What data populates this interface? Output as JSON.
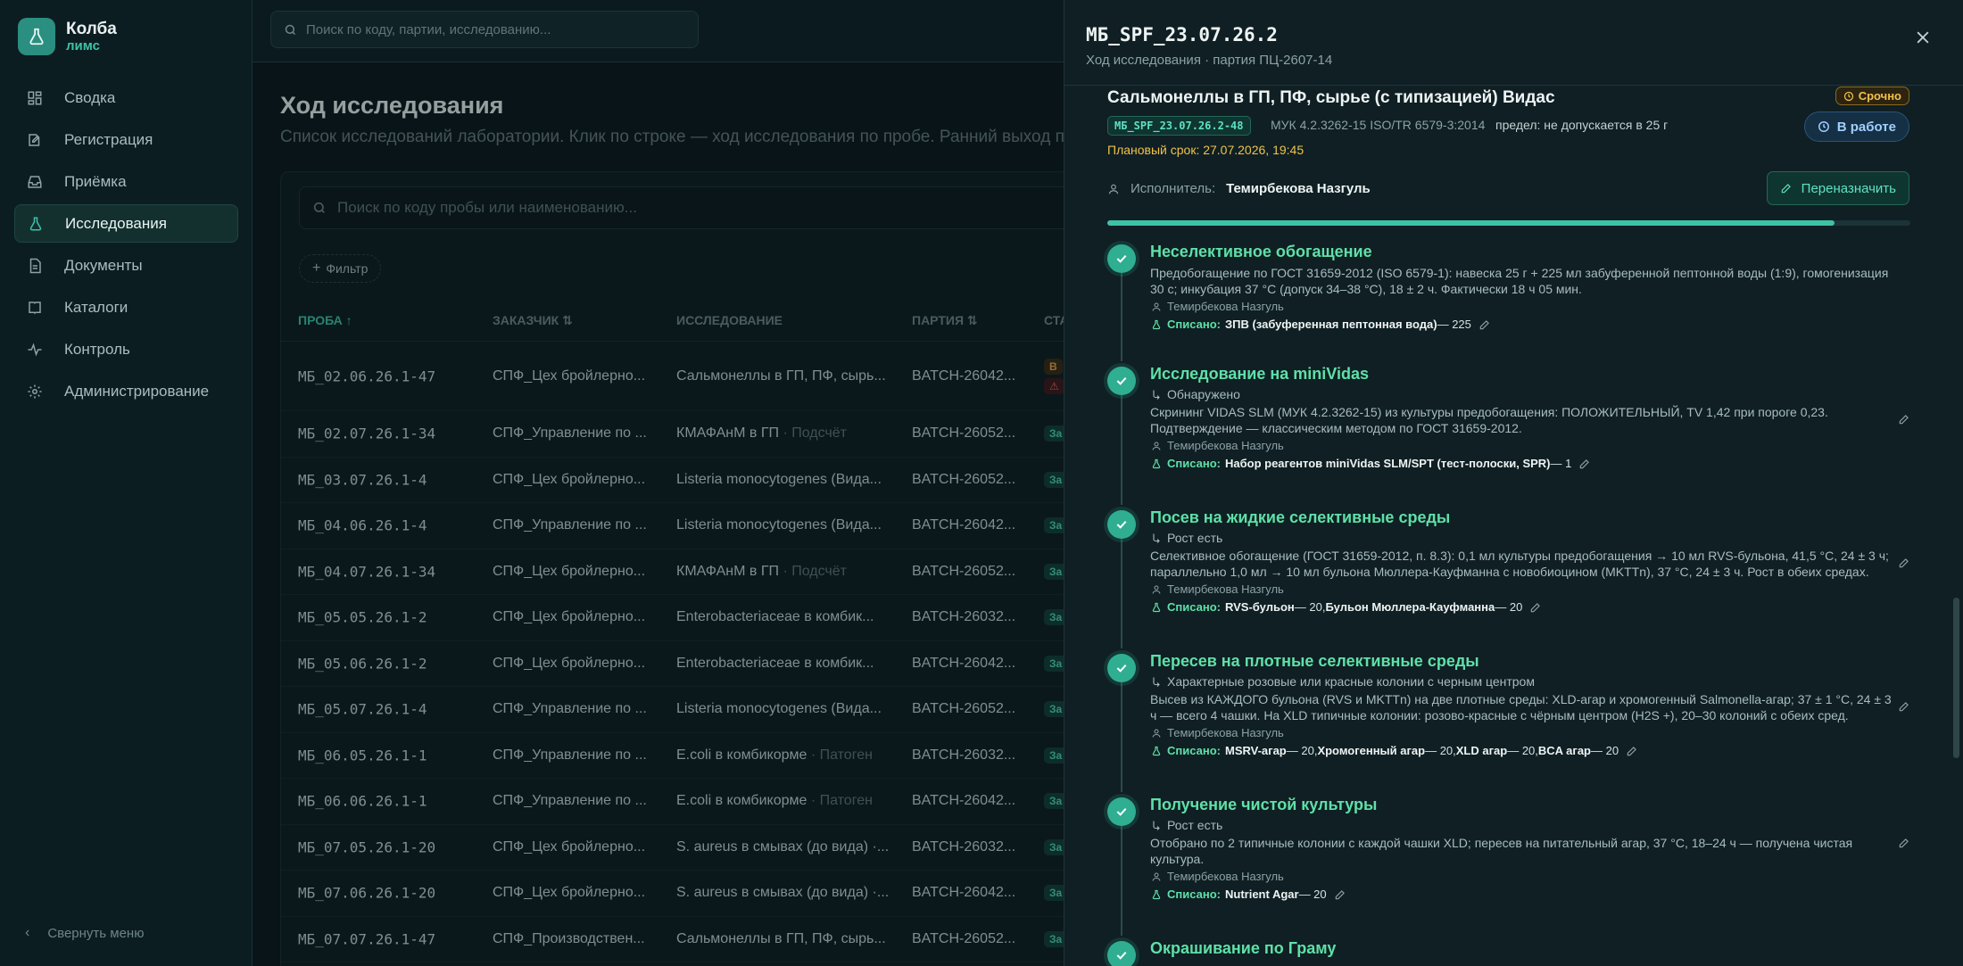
{
  "brand": {
    "name": "Колба",
    "sub": "лимс"
  },
  "nav": [
    {
      "label": "Сводка",
      "icon": "dashboard-icon"
    },
    {
      "label": "Регистрация",
      "icon": "register-icon"
    },
    {
      "label": "Приёмка",
      "icon": "inbox-icon"
    },
    {
      "label": "Исследования",
      "icon": "flask-icon",
      "active": true
    },
    {
      "label": "Документы",
      "icon": "document-icon"
    },
    {
      "label": "Каталоги",
      "icon": "book-icon"
    },
    {
      "label": "Контроль",
      "icon": "pulse-icon"
    },
    {
      "label": "Администрирование",
      "icon": "gear-icon"
    }
  ],
  "collapse_label": "Свернуть меню",
  "global_search": {
    "placeholder": "Поиск по коду, партии, исследованию..."
  },
  "page": {
    "title": "Ход исследования",
    "subtitle": "Список исследований лаборатории. Клик по строке — ход исследования по пробе. Ранний выход по от"
  },
  "table": {
    "search_placeholder": "Поиск по коду пробы или наименованию...",
    "filter_label": "Фильтр",
    "columns": {
      "probe": "ПРОБА",
      "client": "ЗАКАЗЧИК",
      "study": "ИССЛЕДОВАНИЕ",
      "batch": "ПАРТИЯ",
      "status": "СТА"
    },
    "rows": [
      {
        "probe": "МБ_02.06.26.1-47",
        "client": "СПФ_Цех бройлерно...",
        "study": "Сальмонеллы в ГП, ПФ, сырь...",
        "note": "",
        "batch": "BATCH-26042...",
        "status": "В",
        "status2": "⚠"
      },
      {
        "probe": "МБ_02.07.26.1-34",
        "client": "СПФ_Управление по ...",
        "study": "КМАФАнМ в ГП",
        "note": " · Подсчёт",
        "batch": "BATCH-26052...",
        "status": "За"
      },
      {
        "probe": "МБ_03.07.26.1-4",
        "client": "СПФ_Цех бройлерно...",
        "study": "Listeria monocytogenes (Вида...",
        "note": "",
        "batch": "BATCH-26052...",
        "status": "За"
      },
      {
        "probe": "МБ_04.06.26.1-4",
        "client": "СПФ_Управление по ...",
        "study": "Listeria monocytogenes (Вида...",
        "note": "",
        "batch": "BATCH-26042...",
        "status": "За"
      },
      {
        "probe": "МБ_04.07.26.1-34",
        "client": "СПФ_Цех бройлерно...",
        "study": "КМАФАнМ в ГП",
        "note": " · Подсчёт",
        "batch": "BATCH-26052...",
        "status": "За"
      },
      {
        "probe": "МБ_05.05.26.1-2",
        "client": "СПФ_Цех бройлерно...",
        "study": "Enterobacteriaceae в комбик...",
        "note": "",
        "batch": "BATCH-26032...",
        "status": "За"
      },
      {
        "probe": "МБ_05.06.26.1-2",
        "client": "СПФ_Цех бройлерно...",
        "study": "Enterobacteriaceae в комбик...",
        "note": "",
        "batch": "BATCH-26042...",
        "status": "За"
      },
      {
        "probe": "МБ_05.07.26.1-4",
        "client": "СПФ_Управление по ...",
        "study": "Listeria monocytogenes (Вида...",
        "note": "",
        "batch": "BATCH-26052...",
        "status": "За"
      },
      {
        "probe": "МБ_06.05.26.1-1",
        "client": "СПФ_Управление по ...",
        "study": "E.coli в комбикорме",
        "note": " · Патоген",
        "batch": "BATCH-26032...",
        "status": "За"
      },
      {
        "probe": "МБ_06.06.26.1-1",
        "client": "СПФ_Управление по ...",
        "study": "E.coli в комбикорме",
        "note": " · Патоген",
        "batch": "BATCH-26042...",
        "status": "За"
      },
      {
        "probe": "МБ_07.05.26.1-20",
        "client": "СПФ_Цех бройлерно...",
        "study": "S. aureus в смывах (до вида) ·...",
        "note": "",
        "batch": "BATCH-26032...",
        "status": "За"
      },
      {
        "probe": "МБ_07.06.26.1-20",
        "client": "СПФ_Цех бройлерно...",
        "study": "S. aureus в смывах (до вида) ·...",
        "note": "",
        "batch": "BATCH-26042...",
        "status": "За"
      },
      {
        "probe": "МБ_07.07.26.1-47",
        "client": "СПФ_Производствен...",
        "study": "Сальмонеллы в ГП, ПФ, сырь...",
        "note": "",
        "batch": "BATCH-26052...",
        "status": "За"
      }
    ]
  },
  "drawer": {
    "title": "МБ_SPF_23.07.26.2",
    "subtitle": "Ход исследования · партия ПЦ-2607-14",
    "study_title": "Сальмонеллы в ГП, ПФ, сырье (с типизацией) Видас",
    "urgent_label": "Срочно",
    "code_chip": "МБ_SPF_23.07.26.2-48",
    "method": "МУК 4.2.3262-15 ISO/TR 6579-3:2014",
    "limit": "предел: не допускается в 25 г",
    "status_label": "В работе",
    "deadline": "Плановый срок: 27.07.2026, 19:45",
    "executor_label": "Исполнитель:",
    "executor_name": "Темирбекова Назгуль",
    "reassign_label": "Переназначить",
    "progress": 0.905,
    "writeoff_label": "Списано:",
    "steps": [
      {
        "title": "Неселективное обогащение",
        "outcome": "",
        "text": "Предобогащение по ГОСТ 31659-2012 (ISO 6579-1): навеска 25 г + 225 мл забуференной пептонной воды (1:9), гомогенизация 30 с; инкубация 37 °C (допуск 34–38 °C), 18 ± 2 ч. Фактически 18 ч 05 мин.",
        "person": "Темирбекова Назгуль",
        "writeoffs": [
          {
            "name": "ЗПВ (забуференная пептонная вода)",
            "qty": " — 225"
          }
        ]
      },
      {
        "title": "Исследование на miniVidas",
        "outcome": "Обнаружено",
        "text": "Скрининг VIDAS SLM (МУК 4.2.3262-15) из культуры предобогащения: ПОЛОЖИТЕЛЬНЫЙ, TV 1,42 при пороге 0,23. Подтверждение — классическим методом по ГОСТ 31659-2012.",
        "person": "Темирбекова Назгуль",
        "writeoffs": [
          {
            "name": "Набор реагентов miniVidas SLM/SPT (тест-полоски, SPR)",
            "qty": " — 1"
          }
        ]
      },
      {
        "title": "Посев на жидкие селективные среды",
        "outcome": "Рост есть",
        "text": "Селективное обогащение (ГОСТ 31659-2012, п. 8.3): 0,1 мл культуры предобогащения → 10 мл RVS-бульона, 41,5 °C, 24 ± 3 ч; параллельно 1,0 мл → 10 мл бульона Мюллера-Кауфманна с новобиоцином (MKTTn), 37 °C, 24 ± 3 ч. Рост в обеих средах.",
        "person": "Темирбекова Назгуль",
        "writeoffs": [
          {
            "name": "RVS-бульон",
            "qty": " — 20, "
          },
          {
            "name": "Бульон Мюллера-Кауфманна",
            "qty": " — 20"
          }
        ]
      },
      {
        "title": "Пересев на плотные селективные среды",
        "outcome": "Характерные розовые или красные колонии с черным центром",
        "text": "Высев из КАЖДОГО бульона (RVS и MKTTn) на две плотные среды: XLD-агар и хромогенный Salmonella-агар; 37 ± 1 °C, 24 ± 3 ч — всего 4 чашки. На XLD типичные колонии: розово-красные с чёрным центром (H2S +), 20–30 колоний с обеих сред.",
        "person": "Темирбекова Назгуль",
        "writeoffs": [
          {
            "name": "MSRV-агар",
            "qty": " — 20, "
          },
          {
            "name": "Хромогенный агар",
            "qty": " — 20, "
          },
          {
            "name": "XLD агар",
            "qty": " — 20, "
          },
          {
            "name": "BCA агар",
            "qty": " — 20"
          }
        ]
      },
      {
        "title": "Получение чистой культуры",
        "outcome": "Рост есть",
        "text": "Отобрано по 2 типичные колонии с каждой чашки XLD; пересев на питательный агар, 37 °C, 18–24 ч — получена чистая культура.",
        "person": "Темирбекова Назгуль",
        "writeoffs": [
          {
            "name": "Nutrient Agar",
            "qty": " — 20"
          }
        ]
      },
      {
        "title": "Окрашивание по Граму",
        "outcome": "",
        "text": "",
        "person": "",
        "writeoffs": []
      }
    ]
  }
}
